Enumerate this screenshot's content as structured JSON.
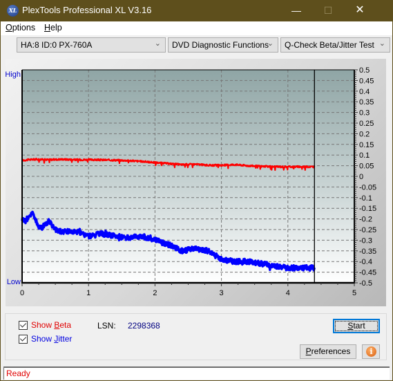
{
  "window": {
    "title": "PlexTools Professional XL V3.16",
    "app_icon_text": "XL",
    "controls": {
      "minimize": "—",
      "maximize": "☐",
      "close": "✕"
    }
  },
  "menu": {
    "items": [
      {
        "label": "Options",
        "accel": "O"
      },
      {
        "label": "Help",
        "accel": "H"
      }
    ]
  },
  "toolbar": {
    "drive": "HA:8 ID:0  PX-760A",
    "function_group": "DVD Diagnostic Functions",
    "test": "Q-Check Beta/Jitter Test"
  },
  "controls": {
    "show_beta": {
      "label": "Show Beta",
      "checked": true
    },
    "show_jitter": {
      "label": "Show Jitter",
      "checked": true
    },
    "lsn_label": "LSN:",
    "lsn_value": "2298368",
    "start_label": "Start",
    "preferences_label": "Preferences",
    "info_icon": "i"
  },
  "status": {
    "text": "Ready"
  },
  "colors": {
    "beta": "#ff0000",
    "jitter": "#0000ff",
    "high_low_labels": "#0000cc",
    "title_bar": "#5e4f1c"
  },
  "chart_data": {
    "type": "line",
    "title": "",
    "xlabel": "",
    "ylabel": "",
    "xlim": [
      0,
      5
    ],
    "ylim": [
      -0.5,
      0.5
    ],
    "x_ticks": [
      "0",
      "1",
      "2",
      "3",
      "4",
      "5"
    ],
    "y_ticks": [
      "0.5",
      "0.45",
      "0.4",
      "0.35",
      "0.3",
      "0.25",
      "0.2",
      "0.15",
      "0.1",
      "0.05",
      "0",
      "-0.05",
      "-0.1",
      "-0.15",
      "-0.2",
      "-0.25",
      "-0.3",
      "-0.35",
      "-0.4",
      "-0.45",
      "-0.5"
    ],
    "y_label_high": "High",
    "y_label_low": "Low",
    "grid": true,
    "end_marker_x": 4.4,
    "series": [
      {
        "name": "Beta",
        "color": "#ff0000",
        "x": [
          0,
          0.1,
          0.2,
          0.4,
          0.6,
          0.8,
          1.0,
          1.2,
          1.4,
          1.6,
          1.8,
          2.0,
          2.2,
          2.4,
          2.6,
          2.8,
          3.0,
          3.2,
          3.4,
          3.6,
          3.8,
          4.0,
          4.2,
          4.4
        ],
        "y": [
          0.075,
          0.078,
          0.08,
          0.078,
          0.08,
          0.078,
          0.078,
          0.077,
          0.076,
          0.074,
          0.07,
          0.065,
          0.06,
          0.055,
          0.057,
          0.052,
          0.052,
          0.055,
          0.05,
          0.047,
          0.045,
          0.045,
          0.045,
          0.045
        ]
      },
      {
        "name": "Jitter",
        "color": "#0000ff",
        "x": [
          0,
          0.05,
          0.1,
          0.15,
          0.2,
          0.25,
          0.3,
          0.4,
          0.5,
          0.6,
          0.8,
          1.0,
          1.2,
          1.4,
          1.6,
          1.8,
          2.0,
          2.2,
          2.4,
          2.6,
          2.8,
          3.0,
          3.2,
          3.4,
          3.6,
          3.8,
          4.0,
          4.2,
          4.4
        ],
        "y": [
          -0.2,
          -0.21,
          -0.19,
          -0.17,
          -0.2,
          -0.24,
          -0.24,
          -0.21,
          -0.25,
          -0.26,
          -0.26,
          -0.28,
          -0.27,
          -0.28,
          -0.29,
          -0.28,
          -0.3,
          -0.32,
          -0.35,
          -0.34,
          -0.35,
          -0.39,
          -0.4,
          -0.4,
          -0.41,
          -0.42,
          -0.43,
          -0.43,
          -0.43
        ]
      }
    ]
  }
}
